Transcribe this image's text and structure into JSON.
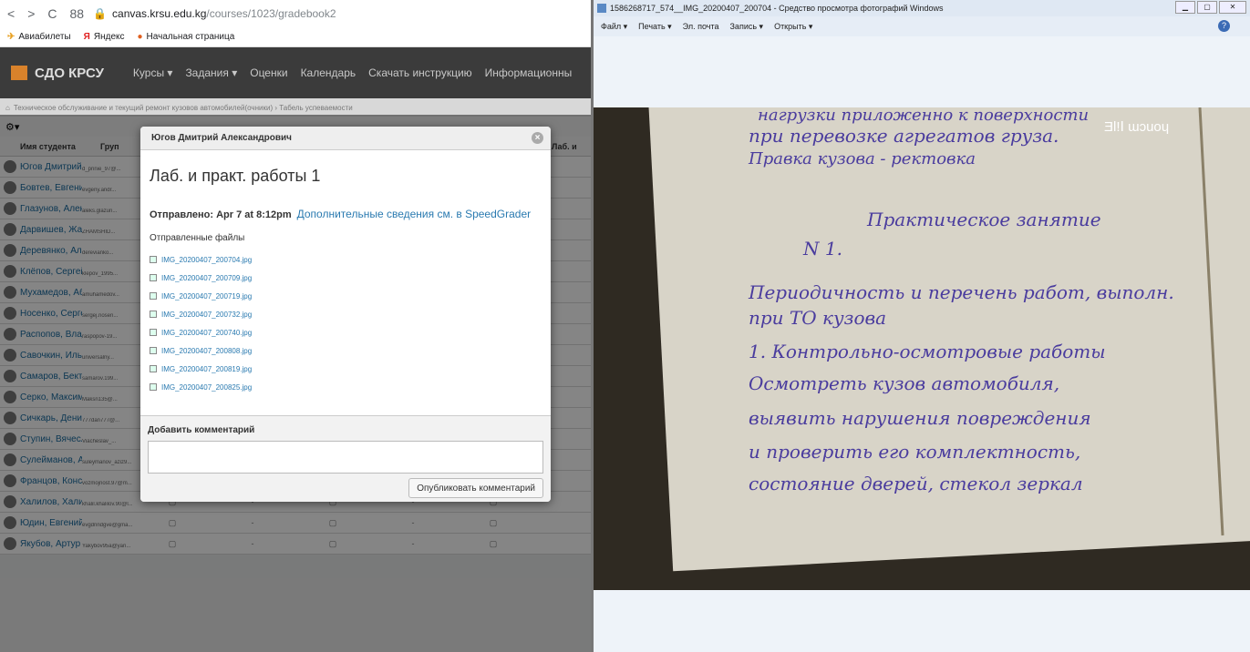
{
  "browser": {
    "address": {
      "host": "canvas.krsu.edu.kg",
      "path": "/courses/1023/gradebook2"
    },
    "bookmarks": [
      "Авиабилеты",
      "Яндекс",
      "Начальная страница"
    ]
  },
  "site": {
    "logo": "СДО КРСУ",
    "nav": [
      "Курсы ▾",
      "Задания ▾",
      "Оценки",
      "Календарь",
      "Скачать инструкцию",
      "Информационны"
    ],
    "breadcrumb": "Техническое обслуживание и текущий ремонт кузовов автомобилей(очники)  ›  Табель успеваемости"
  },
  "grid": {
    "header_name": "Имя студента",
    "header_group": "Груп",
    "header_extra": "Лаб. и",
    "students": [
      {
        "name": "Югов Дмитрий Ал",
        "email": "d_prinie_97@..."
      },
      {
        "name": "Бовтев, Евгений А",
        "email": "evgeny.andr..."
      },
      {
        "name": "Глазунов, Алекса",
        "email": "aleks.glazun..."
      },
      {
        "name": "Дарвишев, Жамш",
        "email": "ZHAMSHID..."
      },
      {
        "name": "Деревянко, Алекс",
        "email": "derevianko..."
      },
      {
        "name": "Клёпов, Сергей Г",
        "email": "klepov_1995..."
      },
      {
        "name": "Мухамедов, Абду",
        "email": "amuhamedov..."
      },
      {
        "name": "Носенко, Сергей",
        "email": "sergej.nosen..."
      },
      {
        "name": "Распопов, Влади",
        "email": "raspopov-19..."
      },
      {
        "name": "Савочкин, Илья Е",
        "email": "universalny..."
      },
      {
        "name": "Самаров, Бектем",
        "email": "samarov.199..."
      },
      {
        "name": "Серко, Максим С",
        "email": "Maksn135@..."
      },
      {
        "name": "Сичкарь, Денис А",
        "email": "777dan777@..."
      },
      {
        "name": "Ступин, Вячеслав",
        "email": "Viacheslav_..."
      },
      {
        "name": "Сулейманов, Ази",
        "email": "suleymanov_aziz9..."
      },
      {
        "name": "Францов, Констан",
        "email": "vozmojnost.97@m..."
      },
      {
        "name": "Халилов, Халил Г",
        "email": "khalil.khalilov.90@l..."
      },
      {
        "name": "Юдин, Евгений С",
        "email": "evgdnndgve@gma..."
      },
      {
        "name": "Якубов, Артур Ру",
        "email": "Yakybov95a@yan..."
      }
    ],
    "dash": "-"
  },
  "dialog": {
    "header": "Югов Дмитрий Александрович",
    "title": "Лаб. и практ. работы 1",
    "sent": "Отправлено: Apr 7 at 8:12pm",
    "speedgrader": "Дополнительные сведения см. в SpeedGrader",
    "files_heading": "Отправленные файлы",
    "files": [
      "IMG_20200407_200704.jpg",
      "IMG_20200407_200709.jpg",
      "IMG_20200407_200719.jpg",
      "IMG_20200407_200732.jpg",
      "IMG_20200407_200740.jpg",
      "IMG_20200407_200808.jpg",
      "IMG_20200407_200819.jpg",
      "IMG_20200407_200825.jpg"
    ],
    "comment_label": "Добавить комментарий",
    "publish": "Опубликовать комментарий"
  },
  "viewer": {
    "title": "1586268717_574__IMG_20200407_200704 - Средство просмотра фотографий Windows",
    "menu": [
      "Файл ▾",
      "Печать ▾",
      "Эл. почта",
      "Запись ▾",
      "Открыть ▾"
    ],
    "watermark": "ƎƖ!ꓲ ɯɔuoɥ",
    "handwriting": [
      "нагрузки приложенно к поверхности",
      "при перевозке агрегатов груза.",
      "Правка кузова - ректовка",
      "Практическое занятие",
      "N 1.",
      "Периодичность и перечень работ, выполн.",
      "при ТО кузова",
      "1. Контрольно-осмотровые работы",
      "Осмотреть кузов автомобиля,",
      "выявить нарушения повреждения",
      "и проверить его комплектность,",
      "состояние дверей, стекол зеркал"
    ]
  },
  "colors": {
    "link": "#2a7ab0",
    "nav_bg": "#3b3b3b",
    "accent": "#d9822b",
    "ink": "#4a3c9e"
  }
}
